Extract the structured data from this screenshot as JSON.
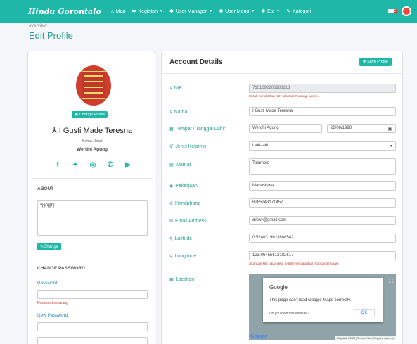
{
  "navbar": {
    "brand": "Hindu Gorontalo",
    "items": [
      {
        "icon": "map-icon",
        "glyph": "⌂",
        "label": "Map",
        "caret": false
      },
      {
        "icon": "gear-icon",
        "glyph": "✱",
        "label": "Kegiatan",
        "caret": true
      },
      {
        "icon": "gear-icon",
        "glyph": "✱",
        "label": "User Manager",
        "caret": true
      },
      {
        "icon": "gear-icon",
        "glyph": "✱",
        "label": "User Menu",
        "caret": true
      },
      {
        "icon": "gear-icon",
        "glyph": "✱",
        "label": "Etc",
        "caret": true
      },
      {
        "icon": "edit-icon",
        "glyph": "✎",
        "label": "Kategori",
        "caret": false
      }
    ],
    "notif_count": "0"
  },
  "header": {
    "breadcrumb": "overview",
    "title": "Edit Profile"
  },
  "profile": {
    "change_profile_label": "Change Profile",
    "name": "I Gusti Made Teresna",
    "role": "Ketua Umat",
    "place": "Werdhi Agung",
    "socials": [
      "facebook-icon",
      "twitter-icon",
      "instagram-icon",
      "whatsapp-icon",
      "youtube-icon"
    ]
  },
  "about": {
    "title": "ABOUT",
    "text": "vjghjghj",
    "change_label": "Change"
  },
  "password": {
    "title": "CHANGE PASSWORD",
    "current_label": "Password",
    "current_help": "Password sekarang",
    "new_label": "New Password"
  },
  "account": {
    "title": "Account Details",
    "save_label": "Save Profile",
    "nik_label": "NIK",
    "nik_value": "7101092206980213",
    "nik_hint": "Untuk perubahan NIK silahkan hubungi admin.",
    "nama_label": "Nama",
    "nama_value": "I Gusti Made Teresna",
    "ttl_label": "Tempat / Tanggal Lahir",
    "tempat_value": "Werdhi Agung",
    "tanggal_value": "22/06/1998",
    "jk_label": "Jenis Kelamin",
    "jk_value": "Laki-laki",
    "alamat_label": "Alamat",
    "alamat_value": "Talumolo",
    "pekerjaan_label": "Pekerjaan",
    "pekerjaan_value": "Mahasiswa",
    "hp_label": "Handphone",
    "hp_value": "6285243171457",
    "email_label": "Email Address",
    "email_value": "arbay@gmail.com",
    "lat_label": "Latitude",
    "lat_value": "0.5240319623888542",
    "lng_label": "Longitude",
    "lng_value": "123.06455612182617",
    "lng_hint": "Silahkan klik pada peta untuk mendapatkan koordinat lokasi !",
    "location_label": "Location"
  },
  "map": {
    "dialog_title": "Google",
    "dialog_msg": "This page can't load Google Maps correctly.",
    "dialog_own": "Do you own this website?",
    "ok_label": "OK",
    "logo": "Google",
    "footer": "Map data ©2020 | Terms of Use | Report a map error"
  },
  "colors": {
    "accent": "#1fb8a8",
    "error": "#c0392b"
  }
}
